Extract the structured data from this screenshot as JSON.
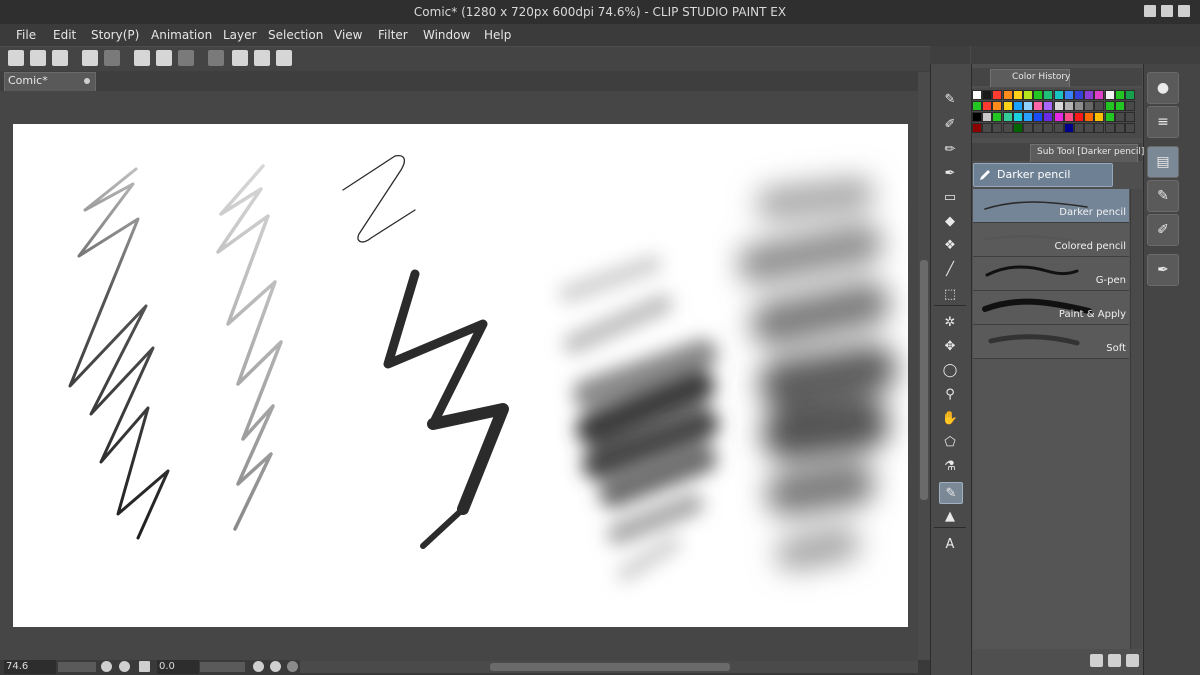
{
  "window": {
    "title": "Comic* (1280 x 720px 600dpi 74.6%)  - CLIP STUDIO PAINT EX"
  },
  "menu": [
    "File",
    "Edit",
    "Story(P)",
    "Animation",
    "Layer",
    "Selection",
    "View",
    "Filter",
    "Window",
    "Help"
  ],
  "document_tab": {
    "label": "Comic*"
  },
  "status": {
    "zoom": "74.6",
    "rotation": "0.0"
  },
  "color_history": {
    "tab_label": "Color History",
    "swatches": [
      [
        "#ffffff",
        "#1a1a1a",
        "#ff3b30",
        "#ff8c1a",
        "#ffd21a",
        "#b5e61d",
        "#22c522",
        "#1fbf7a",
        "#19c3c3",
        "#3b82f6",
        "#3340d9",
        "#8a3ed6",
        "#e040c8",
        "#f2f2f2",
        "#22c522",
        "#17a04a"
      ],
      [
        "#22c522",
        "#ff3b30",
        "#ff8c1a",
        "#ffd21a",
        "#1aa3ff",
        "#8fd0ff",
        "#ff66aa",
        "#aa66ff",
        "#d9d9d9",
        "#b3b3b3",
        "#8c8c8c",
        "#666666",
        "#4d4d4d",
        "#22c522",
        "#22c522",
        "#4a4a4a"
      ],
      [
        "#000000",
        "#c8c8c8",
        "#22c522",
        "#33cc99",
        "#1ad0e0",
        "#2aa0ff",
        "#1a4dff",
        "#6a2ae6",
        "#e62ae6",
        "#ff4d88",
        "#ff1a1a",
        "#ff6a00",
        "#ffbf00",
        "#22c522",
        "#4a4a4a",
        "#4a4a4a"
      ],
      [
        "#8b0000",
        "#4a4a4a",
        "#4a4a4a",
        "#4a4a4a",
        "#006400",
        "#4a4a4a",
        "#4a4a4a",
        "#4a4a4a",
        "#4a4a4a",
        "#00008b",
        "#4a4a4a",
        "#4a4a4a",
        "#4a4a4a",
        "#4a4a4a",
        "#4a4a4a",
        "#4a4a4a"
      ]
    ]
  },
  "sub_tool": {
    "tab_label": "Sub Tool [Darker pencil]",
    "group_label": "Darker pencil",
    "brushes": [
      {
        "name": "Darker pencil",
        "selected": true
      },
      {
        "name": "Colored pencil",
        "selected": false
      },
      {
        "name": "G-pen",
        "selected": false
      },
      {
        "name": "Paint & Apply",
        "selected": false
      },
      {
        "name": "Soft",
        "selected": false
      }
    ]
  },
  "tool_palette": {
    "tools": [
      {
        "name": "pen-tool",
        "glyph": "✎"
      },
      {
        "name": "pencil-tool",
        "glyph": "✐"
      },
      {
        "name": "brush-tool",
        "glyph": "✏"
      },
      {
        "name": "airbrush-tool",
        "glyph": "✒"
      },
      {
        "name": "eraser-tool",
        "glyph": "▭"
      },
      {
        "name": "fill-tool",
        "glyph": "◆"
      },
      {
        "name": "decoration-tool",
        "glyph": "❖"
      },
      {
        "name": "blend-tool",
        "glyph": "╱"
      },
      {
        "name": "selection-tool",
        "glyph": "⬚"
      },
      {
        "name": "auto-select-tool",
        "glyph": "✲"
      },
      {
        "name": "move-tool",
        "glyph": "✥"
      },
      {
        "name": "lasso-tool",
        "glyph": "◯"
      },
      {
        "name": "zoom-tool",
        "glyph": "⚲"
      },
      {
        "name": "hand-tool",
        "glyph": "✋"
      },
      {
        "name": "object-tool",
        "glyph": "⬠"
      },
      {
        "name": "eyedropper-tool",
        "glyph": "⚗"
      },
      {
        "name": "active-pen-tool",
        "glyph": "✎"
      },
      {
        "name": "stamp-tool",
        "glyph": "▲"
      },
      {
        "name": "text-tool",
        "glyph": "A"
      }
    ]
  }
}
